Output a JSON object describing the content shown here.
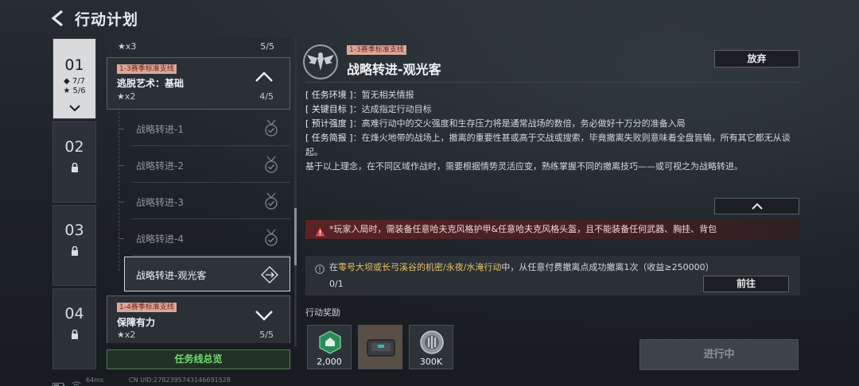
{
  "header": {
    "title": "行动计划"
  },
  "chapters": [
    {
      "num": "01",
      "stat1": "◆ 7/7",
      "stat2": "★ 5/6",
      "locked": false,
      "active": true
    },
    {
      "num": "02",
      "locked": true
    },
    {
      "num": "03",
      "locked": true
    },
    {
      "num": "04",
      "locked": true
    }
  ],
  "mission_list": {
    "top_row": {
      "stars": "★x3",
      "count": "5/5"
    },
    "group1": {
      "tag": "1-3赛季标准支线",
      "name": "逃脱艺术：基础",
      "stars": "★x2",
      "count": "4/5"
    },
    "items": [
      {
        "label": "战略转进-1"
      },
      {
        "label": "战略转进-2"
      },
      {
        "label": "战略转进-3"
      },
      {
        "label": "战略转进-4"
      },
      {
        "label": "战略转进-观光客"
      }
    ],
    "group2": {
      "tag": "1-4赛季标准支线",
      "name": "保障有力",
      "stars": "★x2",
      "count": "5/5"
    },
    "overview_button": "任务线总览"
  },
  "detail": {
    "tag": "1-3赛季标准支线",
    "title": "战略转进-观光客",
    "giveup_button": "放弃",
    "env_key": "[ 任务环境 ]",
    "env_val": "：暂无相关情报",
    "goal_key": "[ 关键目标 ]",
    "goal_val": "：达成指定行动目标",
    "intensity_key": "[ 预计强度 ]",
    "intensity_val": "：高难行动中的交火强度和生存压力将是通常战场的数倍，务必做好十万分的准备入局",
    "brief_key": "[ 任务简报 ]",
    "brief_val": "：在烽火地带的战场上，撤离的重要性甚或高于交战或搜索，毕竟撤离失败则意味着全盘皆输，所有其它都无从谈起。",
    "extra": "基于以上理念，在不同区域作战时，需要根据情势灵活应变，熟练掌握不同的撤离技巧——或可视之为战略转进。",
    "warning": "*玩家入局时，需装备任意哈夫克风格护甲&任意哈夫克风格头盔，且不能装备任何武器、胸挂、背包",
    "objective_pre": "在",
    "objective_hl": "零号大坝或长弓溪谷的机密/永夜/水淹行动",
    "objective_post": "中，从任意付费撤离点成功撤离1次（收益≥250000）",
    "objective_progress": "0/1",
    "goto_button": "前往",
    "reward_label": "行动奖励",
    "rewards": [
      {
        "icon": "reward-badge-icon",
        "amount": "2,000"
      },
      {
        "icon": "reward-case-icon",
        "amount": ""
      },
      {
        "icon": "reward-coin-icon",
        "amount": "300K"
      }
    ],
    "progress_button": "进行中"
  },
  "footer": {
    "ping": "64ms",
    "uid": "CN UID:2782395743146691528"
  },
  "colors": {
    "accent_green": "#6fdc6d",
    "tag_red": "#d9a89a",
    "warn_red": "#5a2326",
    "highlight_gold": "#e7c36a"
  }
}
